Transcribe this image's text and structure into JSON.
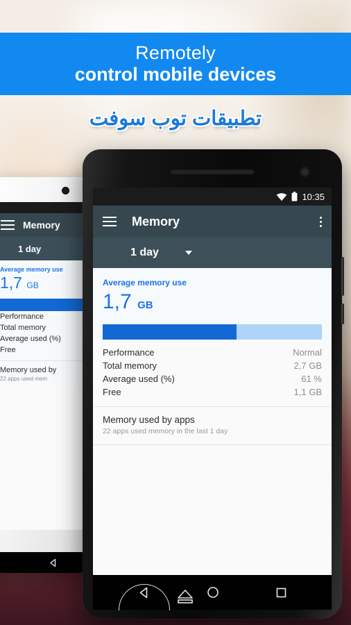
{
  "banner": {
    "line1": "Remotely",
    "line2": "control mobile devices",
    "color": "#1289f0"
  },
  "brand": {
    "text": "تطبيقات توب سوفت",
    "color": "#1a79d8"
  },
  "phone": {
    "statusbar": {
      "time": "10:35",
      "wifi_icon": "wifi-icon",
      "battery_icon": "battery-icon"
    },
    "toolbar": {
      "menu_icon": "hamburger-menu-icon",
      "title": "Memory",
      "overflow_icon": "kebab-overflow-icon"
    },
    "period_selector": {
      "value": "1 day",
      "caret_icon": "chevron-down-icon"
    },
    "card": {
      "label": "Average memory use",
      "value": "1,7",
      "unit": "GB",
      "progress_percent": 61,
      "fill_color": "#1269d3",
      "track_color": "#aed3f7"
    },
    "stats": [
      {
        "key": "Performance",
        "value": "Normal"
      },
      {
        "key": "Total memory",
        "value": "2,7 GB"
      },
      {
        "key": "Average used (%)",
        "value": "61 %"
      },
      {
        "key": "Free",
        "value": "1,1 GB"
      }
    ],
    "apps_section": {
      "title": "Memory used by apps",
      "subtitle": "22 apps used memory in the last 1 day"
    },
    "navbar": {
      "back_icon": "back-triangle-icon",
      "home_icon": "home-circle-icon",
      "recents_icon": "recents-square-icon",
      "eject_icon": "eject-overlay-icon"
    }
  },
  "bgphone": {
    "toolbar_title": "Memory",
    "period": "1 day",
    "card_label": "Average memory use",
    "card_value": "1,7",
    "card_unit": "GB",
    "stats": [
      "Performance",
      "Total memory",
      "Average used (%)",
      "Free"
    ],
    "apps_title": "Memory used by",
    "apps_subtitle": "22 apps used mem",
    "back_icon": "back-triangle-icon"
  }
}
